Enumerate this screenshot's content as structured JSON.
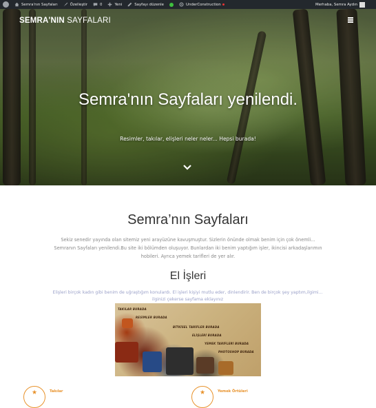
{
  "admin_bar": {
    "site_name": "Semra'nın Sayfaları",
    "customize": "Özelleştir",
    "comments_count": "0",
    "new_label": "Yeni",
    "edit_page": "Sayfayı düzenle",
    "plugin_label": "UnderConstruction",
    "greeting": "Merhaba, Semra Aydın"
  },
  "header": {
    "brand_bold": "SEMRA'NIN",
    "brand_rest": " SAYFALARI"
  },
  "hero": {
    "title": "Semra'nın Sayfaları yenilendi.",
    "subtitle": "Resimler, takılar, elişleri neler neler... Hepsi burada!"
  },
  "main": {
    "section_title": "Semra’nın Sayfaları",
    "intro": "Sekiz senedir yayında olan sitemiz yeni arayüzüne kavuşmuştur. Sizlerin önünde olmak benim için çok önemli... Semranın Sayfaları yenilendi.Bu site iki bölümden oluşuyor. Bunlardan iki benim yaptığım işler, ikincisi arkadaşlarımın hobileri. Ayrıca yemek tarifleri de yer alır.",
    "el_isleri_title": "El İşleri",
    "el_isleri_desc": "Elişleri birçok kadın gibi benim de uğraştığım konulardı. El işleri kişiyi mutlu eder, dinlendirir. Ben de  birçok şey yaptım,ilgimi... ilginizi    çekerse  sayfama eklayınız"
  },
  "puzzle_labels": {
    "l1": "TAKILAR BURADA",
    "l2": "RESİMLER BURADA",
    "l3": "BİTKİSEL TARİFLER BURADA",
    "l4": "ELİŞLERİ BURADA",
    "l5": "YEMEK TARİFLERİ BURADA",
    "l6": "PHOTOSHOP BURADA"
  },
  "features": [
    {
      "label": "Takılar",
      "icon": "star-icon"
    },
    {
      "label": "Yemek Örtüleri",
      "icon": "star-icon"
    }
  ],
  "colors": {
    "admin_bar": "#23282d",
    "accent": "#e8922b",
    "desc_text": "#9aa0c8"
  }
}
